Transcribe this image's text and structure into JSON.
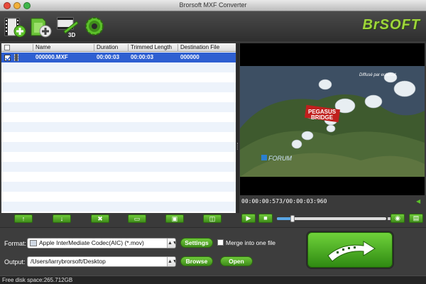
{
  "window": {
    "title": "Brorsoft MXF Converter"
  },
  "toolbar": {
    "buttons": [
      {
        "name": "add-video-icon"
      },
      {
        "name": "add-folder-icon"
      },
      {
        "name": "edit-3d-icon"
      },
      {
        "name": "settings-gear-icon"
      }
    ],
    "logo_text": "BrSOFT"
  },
  "file_list": {
    "headers": [
      "Name",
      "Duration",
      "Trimmed Length",
      "Destination File"
    ],
    "rows": [
      {
        "name": "000000.MXF",
        "duration": "00:00:03",
        "trimmed": "00:00:03",
        "destination": "000000",
        "checked": true
      }
    ]
  },
  "list_buttons": [
    "move-up-icon",
    "move-down-icon",
    "remove-icon",
    "clear-icon",
    "subtitle-icon",
    "merge-icon"
  ],
  "preview": {
    "overlay_text": "Diffusé par eutelsat",
    "sign_text_1": "PEGASUS",
    "sign_text_2": "BRIDGE",
    "channel_logo": "FORUM",
    "timecode": "00:00:00:573/00:00:03:960"
  },
  "bottom": {
    "format_label": "Format:",
    "format_value": "Apple InterMediate Codec(AIC) (*.mov)",
    "settings_label": "Settings",
    "merge_label": "Merge into one file",
    "output_label": "Output:",
    "output_value": "/Users/larrybrorsoft/Desktop",
    "browse_label": "Browse",
    "open_label": "Open"
  },
  "status": {
    "free_space": "Free disk space:265.712GB"
  },
  "colors": {
    "accent_green": "#5cc12a",
    "selection_blue": "#2e5fd1"
  }
}
